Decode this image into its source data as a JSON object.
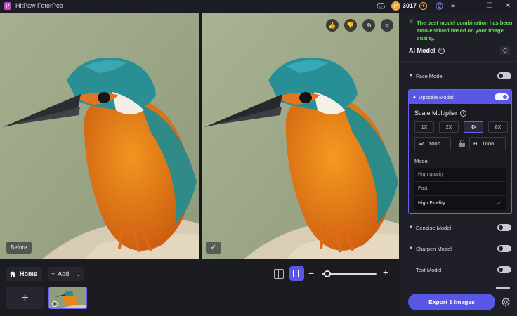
{
  "titlebar": {
    "title": "HitPaw FotorPea",
    "logo_letter": "P",
    "coin_glyph": "P",
    "coins": "3017",
    "icons": [
      "discord-icon",
      "coin-icon",
      "add-coin-icon",
      "account-icon",
      "menu-icon",
      "minimize-icon",
      "maximize-icon",
      "close-icon"
    ]
  },
  "canvas": {
    "before_label": "Before",
    "after_check_glyph": "✓",
    "overlay_buttons": [
      "thumbs-up-icon",
      "thumbs-down-icon",
      "zoom-icon",
      "crop-icon"
    ],
    "glyphs": {
      "thumbs_up": "👍",
      "thumbs_down": "👎",
      "zoom": "⊕",
      "crop": "⌗"
    }
  },
  "bottombar": {
    "home_label": "Home",
    "add_label": "Add",
    "add_glyph": "+",
    "add_chevron": "⌄",
    "zoom_minus": "−",
    "zoom_plus": "+",
    "add_thumb_glyph": "+",
    "zoom_level_fraction": 0.05
  },
  "sidebar": {
    "notice": "The best model combination has been auto-enabled based on your image quality.",
    "notice_icon": "⚡",
    "section_title": "AI Model",
    "info_glyph": "i",
    "refresh_glyph": "C",
    "models": [
      {
        "label": "Face Model",
        "enabled": false
      },
      {
        "label": "Upscale Model",
        "enabled": true
      },
      {
        "label": "Denoise Model",
        "enabled": false
      },
      {
        "label": "Sharpen Model",
        "enabled": false
      },
      {
        "label": "Text Model",
        "enabled": false
      }
    ],
    "upscale": {
      "title": "Scale Multiplier",
      "multipliers": [
        "1X",
        "2X",
        "4X",
        "8X"
      ],
      "selected_multiplier": "4X",
      "width_label": "W",
      "width_value": "1000",
      "height_label": "H",
      "height_value": "1000",
      "mode_label": "Mode",
      "modes": [
        "High quality",
        "Fast",
        "High Fidelity"
      ],
      "selected_mode": "High Fidelity",
      "check_glyph": "✓"
    },
    "export_label": "Export 1 images"
  },
  "colors": {
    "accent": "#5a56e6",
    "notice_green": "#6bdb5c",
    "coin": "#f1a93b",
    "background": "#1b1b22"
  }
}
